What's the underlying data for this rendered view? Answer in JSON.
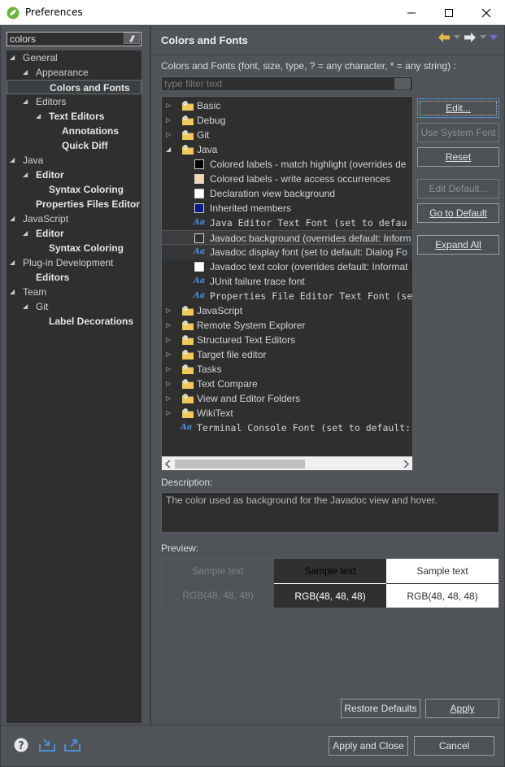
{
  "window": {
    "title": "Preferences"
  },
  "filter": {
    "value": "colors"
  },
  "left_tree": [
    {
      "label": "General",
      "indent": 0,
      "expanded": true,
      "bold": false
    },
    {
      "label": "Appearance",
      "indent": 1,
      "expanded": true,
      "bold": false
    },
    {
      "label": "Colors and Fonts",
      "indent": 2,
      "expanded": null,
      "bold": true,
      "selected": true
    },
    {
      "label": "Editors",
      "indent": 1,
      "expanded": true,
      "bold": false
    },
    {
      "label": "Text Editors",
      "indent": 2,
      "expanded": true,
      "bold": true
    },
    {
      "label": "Annotations",
      "indent": 3,
      "expanded": null,
      "bold": true
    },
    {
      "label": "Quick Diff",
      "indent": 3,
      "expanded": null,
      "bold": true
    },
    {
      "label": "Java",
      "indent": 0,
      "expanded": true,
      "bold": false
    },
    {
      "label": "Editor",
      "indent": 1,
      "expanded": true,
      "bold": true
    },
    {
      "label": "Syntax Coloring",
      "indent": 2,
      "expanded": null,
      "bold": true
    },
    {
      "label": "Properties Files Editor",
      "indent": 1,
      "expanded": null,
      "bold": true
    },
    {
      "label": "JavaScript",
      "indent": 0,
      "expanded": true,
      "bold": false
    },
    {
      "label": "Editor",
      "indent": 1,
      "expanded": true,
      "bold": true
    },
    {
      "label": "Syntax Coloring",
      "indent": 2,
      "expanded": null,
      "bold": true
    },
    {
      "label": "Plug-in Development",
      "indent": 0,
      "expanded": true,
      "bold": false
    },
    {
      "label": "Editors",
      "indent": 1,
      "expanded": null,
      "bold": true
    },
    {
      "label": "Team",
      "indent": 0,
      "expanded": true,
      "bold": false
    },
    {
      "label": "Git",
      "indent": 1,
      "expanded": true,
      "bold": false
    },
    {
      "label": "Label Decorations",
      "indent": 2,
      "expanded": null,
      "bold": true
    }
  ],
  "page": {
    "title": "Colors and Fonts",
    "subtitle": "Colors and Fonts (font, size, type, ? = any character, * = any string) :",
    "type_filter_placeholder": "type filter text",
    "description_label": "Description:",
    "description_text": "The color used as background for the Javadoc view and hover.",
    "preview_label": "Preview:"
  },
  "font_tree": [
    {
      "label": "Basic",
      "kind": "folder",
      "level": 0
    },
    {
      "label": "Debug",
      "kind": "folder",
      "level": 0
    },
    {
      "label": "Git",
      "kind": "folder",
      "level": 0
    },
    {
      "label": "Java",
      "kind": "folder",
      "level": 0,
      "expanded": true
    },
    {
      "label": "Colored labels - match highlight (overrides de",
      "kind": "color",
      "level": 1,
      "color": "#000000"
    },
    {
      "label": "Colored labels - write access occurrences",
      "kind": "color",
      "level": 1,
      "color": "#f2d8b4"
    },
    {
      "label": "Declaration view background",
      "kind": "color",
      "level": 1,
      "color": "#ffffff"
    },
    {
      "label": "Inherited members",
      "kind": "color",
      "level": 1,
      "color": "#0a1a8a"
    },
    {
      "label": "Java Editor Text Font (set to defau",
      "kind": "font",
      "level": 1
    },
    {
      "label": "Javadoc background (overrides default: Inform",
      "kind": "color",
      "level": 1,
      "color": "#303030",
      "selected": true
    },
    {
      "label": "Javadoc display font (set to default: Dialog Fo",
      "kind": "font-prop",
      "level": 1,
      "hover": true
    },
    {
      "label": "Javadoc text color (overrides default: Informat",
      "kind": "color",
      "level": 1,
      "color": "#ffffff"
    },
    {
      "label": "JUnit failure trace font",
      "kind": "font-prop",
      "level": 1
    },
    {
      "label": "Properties File Editor Text Font (se",
      "kind": "font",
      "level": 1
    },
    {
      "label": "JavaScript",
      "kind": "folder",
      "level": 0
    },
    {
      "label": "Remote System Explorer",
      "kind": "folder",
      "level": 0
    },
    {
      "label": "Structured Text Editors",
      "kind": "folder",
      "level": 0
    },
    {
      "label": "Target file editor",
      "kind": "folder",
      "level": 0
    },
    {
      "label": "Tasks",
      "kind": "folder",
      "level": 0
    },
    {
      "label": "Text Compare",
      "kind": "folder",
      "level": 0
    },
    {
      "label": "View and Editor Folders",
      "kind": "folder",
      "level": 0
    },
    {
      "label": "WikiText",
      "kind": "folder",
      "level": 0
    },
    {
      "label": "Terminal Console Font (set to default:",
      "kind": "font",
      "level": -1
    }
  ],
  "side_buttons": {
    "edit": "Edit...",
    "use_system_font": "Use System Font",
    "reset": "Reset",
    "edit_default": "Edit Default...",
    "go_to_default": "Go to Default",
    "expand_all": "Expand All"
  },
  "preview": {
    "sample_text": "Sample text",
    "rgb_text": "RGB(48, 48, 48)",
    "colors": {
      "cell1_bg": "#505357",
      "cell1_fg": "#7f8285",
      "cell2_bg": "#303030",
      "cell2_fg": "#000000",
      "cell3_bg": "#ffffff",
      "cell3_fg": "#303030"
    }
  },
  "buttons": {
    "restore_defaults": "Restore Defaults",
    "apply": "Apply",
    "apply_and_close": "Apply and Close",
    "cancel": "Cancel"
  },
  "colors": {
    "accent": "#4c8fd6",
    "folder": "#e5b84a"
  }
}
